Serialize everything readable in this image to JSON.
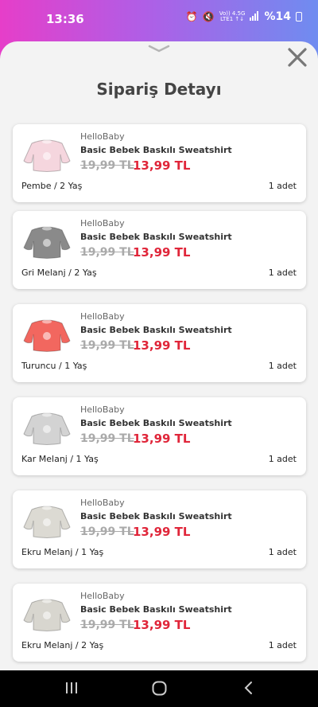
{
  "status": {
    "time": "13:36",
    "net_top": "Vo)) 4.5G",
    "net_bottom": "LTE1 ↑↓",
    "battery": "%14"
  },
  "sheet": {
    "title": "Sipariş Detayı"
  },
  "items": [
    {
      "brand": "HelloBaby",
      "name": "Basic Bebek Baskılı Sweatshirt",
      "old_price": "19,99 TL",
      "new_price": "13,99 TL",
      "variant": "Pembe / 2 Yaş",
      "qty": "1 adet",
      "color": "#f5d6de"
    },
    {
      "brand": "HelloBaby",
      "name": "Basic Bebek Baskılı Sweatshirt",
      "old_price": "19,99 TL",
      "new_price": "13,99 TL",
      "variant": "Gri Melanj / 2 Yaş",
      "qty": "1 adet",
      "color": "#8a8a8a"
    },
    {
      "brand": "HelloBaby",
      "name": "Basic Bebek Baskılı Sweatshirt",
      "old_price": "19,99 TL",
      "new_price": "13,99 TL",
      "variant": "Turuncu / 1 Yaş",
      "qty": "1 adet",
      "color": "#f2675f"
    },
    {
      "brand": "HelloBaby",
      "name": "Basic Bebek Baskılı Sweatshirt",
      "old_price": "19,99 TL",
      "new_price": "13,99 TL",
      "variant": "Kar Melanj / 1 Yaş",
      "qty": "1 adet",
      "color": "#d3d3d3"
    },
    {
      "brand": "HelloBaby",
      "name": "Basic Bebek Baskılı Sweatshirt",
      "old_price": "19,99 TL",
      "new_price": "13,99 TL",
      "variant": "Ekru Melanj / 1 Yaş",
      "qty": "1 adet",
      "color": "#dcdad3"
    },
    {
      "brand": "HelloBaby",
      "name": "Basic Bebek Baskılı Sweatshirt",
      "old_price": "19,99 TL",
      "new_price": "13,99 TL",
      "variant": "Ekru Melanj / 2 Yaş",
      "qty": "1 adet",
      "color": "#d8d6cf"
    }
  ],
  "icons": {
    "handle": "chevron-down-icon",
    "close": "close-icon",
    "nav_recents": "recents-icon",
    "nav_home": "home-icon",
    "nav_back": "back-icon"
  },
  "colors": {
    "price_red": "#e0263a",
    "gradient_start": "#e63ec9",
    "gradient_end": "#6f8cf0"
  }
}
